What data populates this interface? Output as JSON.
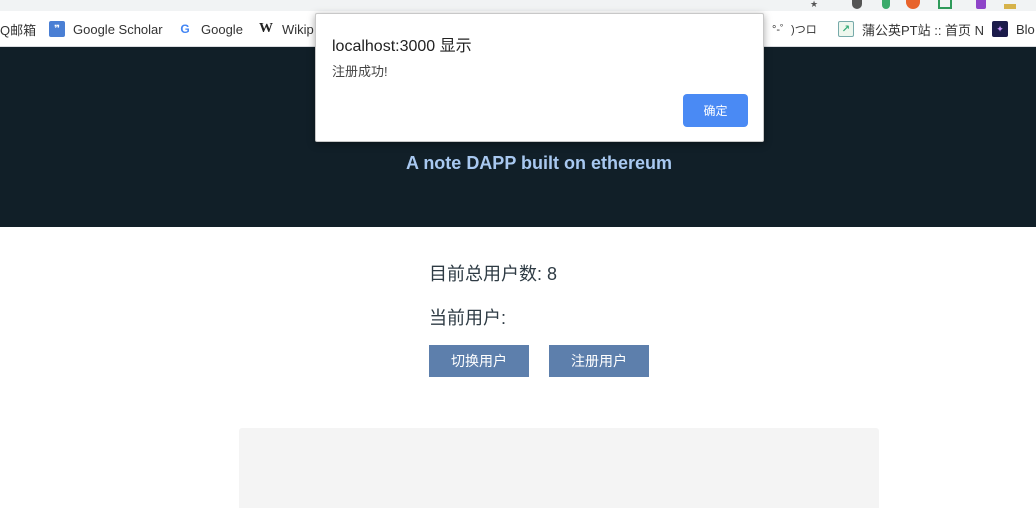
{
  "bookmarks": [
    {
      "label": "Q邮箱",
      "icon": "mail-icon"
    },
    {
      "label": "Google Scholar",
      "icon": "scholar-icon"
    },
    {
      "label": "Google",
      "icon": "google-icon"
    },
    {
      "label": "Wikip",
      "icon": "wikipedia-icon"
    },
    {
      "label": "°-゜)つロ",
      "icon": "none"
    },
    {
      "label": "蒲公英PT站 :: 首页 N",
      "icon": "pt-site-icon"
    },
    {
      "label": "Blo",
      "icon": "blog-icon"
    }
  ],
  "hero": {
    "tagline": "A note DAPP built on ethereum"
  },
  "user_panel": {
    "total_users_label": "目前总用户数: 8",
    "current_user_label": "当前用户:"
  },
  "actions": {
    "switch_user": "切换用户",
    "register_user": "注册用户"
  },
  "alert": {
    "title": "localhost:3000 显示",
    "message": "注册成功!",
    "ok_label": "确定"
  },
  "colors": {
    "hero_bg": "#111f28",
    "tagline": "#a8c8f0",
    "button_bg": "#5d7fac",
    "alert_ok": "#4a8af4"
  }
}
